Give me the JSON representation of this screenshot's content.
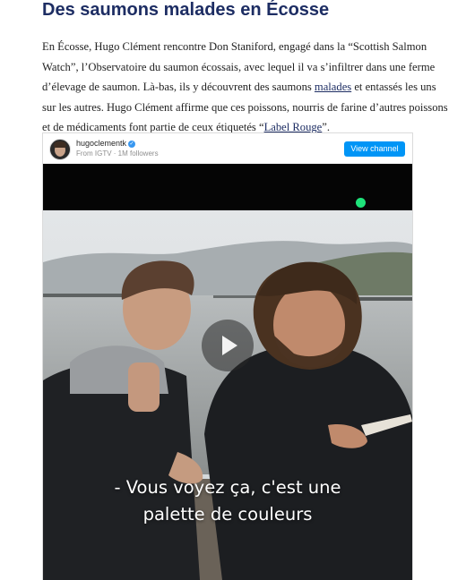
{
  "article": {
    "heading": "Des saumons malades en Écosse",
    "para_1": "En Écosse, Hugo Clément rencontre Don Staniford, engagé dans la “Scottish Salmon Watch”, l’Observatoire du saumon écossais, avec lequel il va s’infiltrer dans une ferme d’élevage de saumon. Là-bas, ils y découvrent des saumons ",
    "link_malades": "malades",
    "para_2": " et entassés les uns sur les autres. Hugo Clément affirme que ces poissons, nourris de farine d’autres poissons et de médicaments font partie de ceux étiquetés “",
    "link_label_rouge": "Label Rouge",
    "para_3": "”."
  },
  "embed": {
    "username": "hugoclementk",
    "meta": "From IGTV · 1M followers",
    "view_button": "View channel",
    "subtitle_line1": "- Vous voyez ça, c'est une",
    "subtitle_line2": "palette de couleurs"
  },
  "colors": {
    "heading": "#1d2d63",
    "link": "#1d2d63",
    "button": "#0095f6",
    "indicator_dot": "#1ee37a"
  },
  "icons": {
    "verified": "verified-badge-icon",
    "play": "play-icon"
  }
}
